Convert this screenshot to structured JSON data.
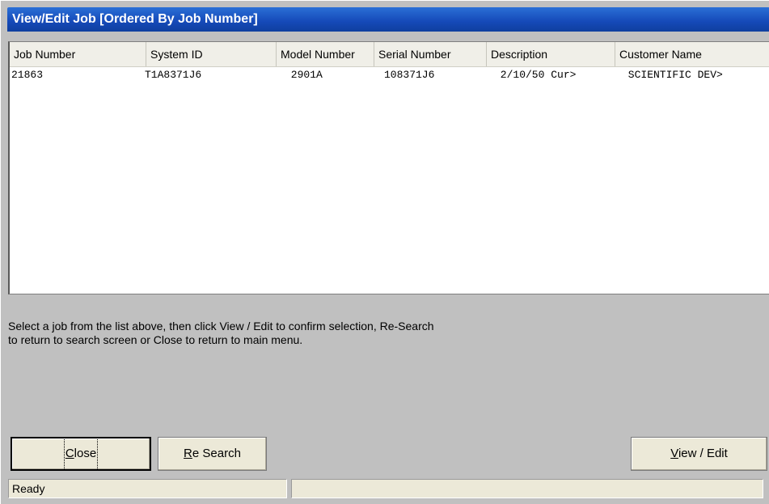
{
  "window": {
    "title": "View/Edit Job [Ordered By Job Number]"
  },
  "list": {
    "columns": [
      "Job Number",
      "System ID",
      "Model Number",
      "Serial Number",
      "Description",
      "Customer Name"
    ],
    "rows": [
      [
        "21863",
        "T1A8371J6",
        " 2901A",
        "108371J6",
        " 2/10/50 Cur>",
        " SCIENTIFIC DEV>"
      ]
    ]
  },
  "instructions": {
    "line1": "Select a job from the list above, then click View / Edit to confirm selection, Re-Search",
    "line2": "to return to search screen or Close to return to main menu."
  },
  "buttons": {
    "close": {
      "mnemonic": "C",
      "rest": "lose"
    },
    "research": {
      "mnemonic": "R",
      "rest": "e Search"
    },
    "view_edit": {
      "mnemonic": "V",
      "rest": "iew / Edit"
    }
  },
  "status": {
    "text": "Ready",
    "pane2": ""
  }
}
